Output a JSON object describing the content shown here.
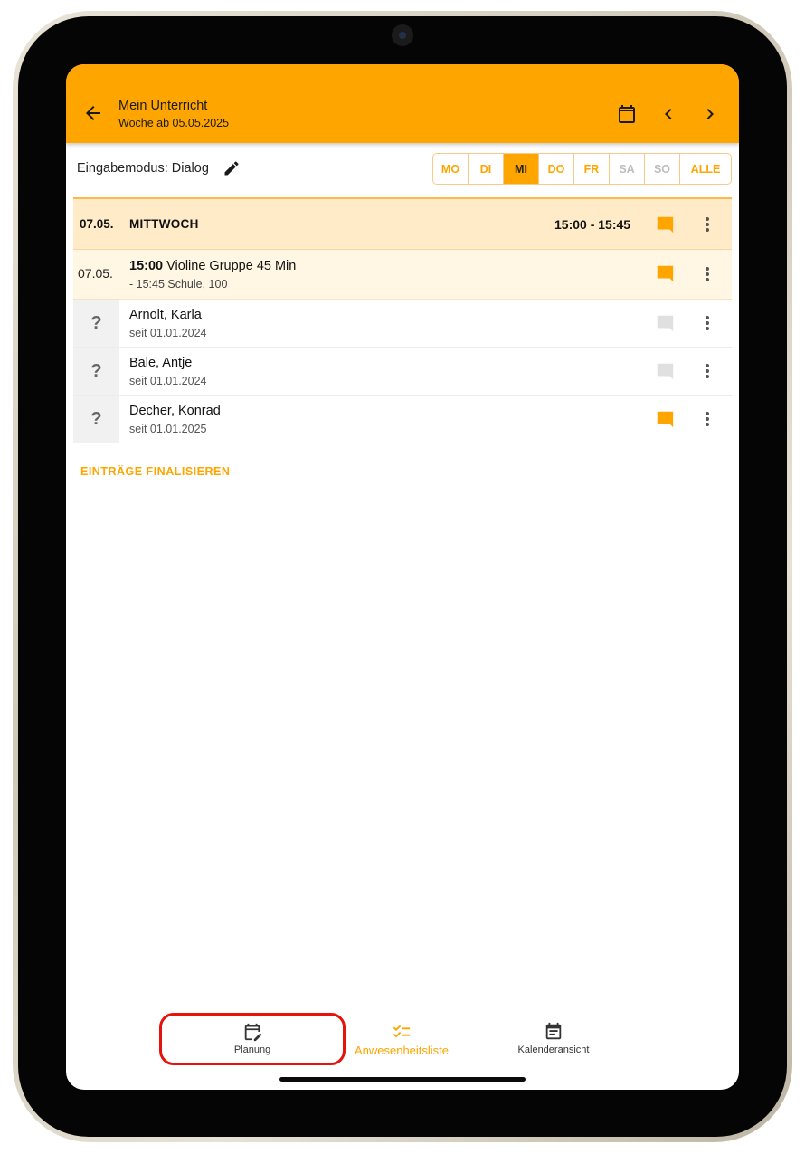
{
  "appbar": {
    "title": "Mein Unterricht",
    "subtitle": "Woche ab 05.05.2025",
    "icons": [
      "arrow-back-icon",
      "calendar-icon",
      "chevron-left-icon",
      "chevron-right-icon"
    ]
  },
  "mode": {
    "label": "Eingabemodus: Dialog",
    "icon": "pencil-icon"
  },
  "day_filter": {
    "days": [
      {
        "label": "MO",
        "state": "enabled"
      },
      {
        "label": "DI",
        "state": "enabled"
      },
      {
        "label": "MI",
        "state": "selected"
      },
      {
        "label": "DO",
        "state": "enabled"
      },
      {
        "label": "FR",
        "state": "enabled"
      },
      {
        "label": "SA",
        "state": "disabled"
      },
      {
        "label": "SO",
        "state": "disabled"
      }
    ],
    "all_label": "ALLE"
  },
  "day_header": {
    "date": "07.05.",
    "day": "MITTWOCH",
    "time": "15:00 - 15:45"
  },
  "lesson": {
    "date": "07.05.",
    "start": "15:00",
    "title": "Violine Gruppe 45 Min",
    "details": "- 15:45 Schule, 100"
  },
  "students": [
    {
      "status": "?",
      "name": "Arnolt, Karla",
      "since": "seit 01.01.2024",
      "has_comment": false
    },
    {
      "status": "?",
      "name": "Bale, Antje",
      "since": "seit 01.01.2024",
      "has_comment": false
    },
    {
      "status": "?",
      "name": "Decher, Konrad",
      "since": "seit 01.01.2025",
      "has_comment": true
    }
  ],
  "finalize_label": "EINTRÄGE FINALISIEREN",
  "bottom_nav": {
    "planung": "Planung",
    "anwesenheit": "Anwesenheitsliste",
    "kalender": "Kalenderansicht"
  },
  "colors": {
    "accent": "#FFA500",
    "header_bg": "#FFEBC8",
    "lesson_bg": "#FFF6E3",
    "comment_inactive": "#E0E0E0",
    "highlight": "#E5130B"
  }
}
